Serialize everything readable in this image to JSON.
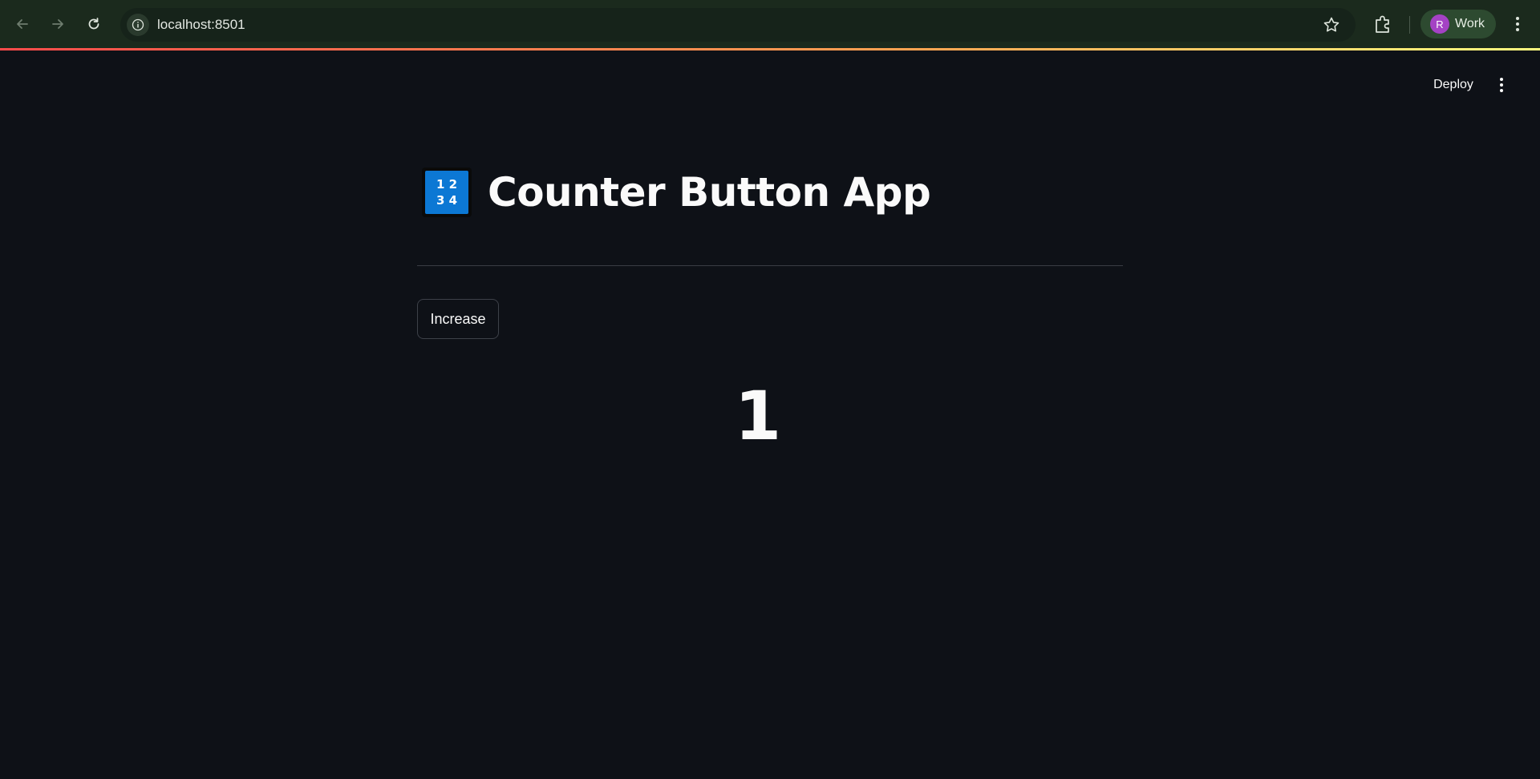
{
  "browser": {
    "url": "localhost:8501",
    "profile": {
      "initial": "R",
      "label": "Work"
    },
    "icons": [
      "back-arrow-icon",
      "forward-arrow-icon",
      "reload-icon",
      "site-info-icon",
      "star-icon",
      "extensions-icon",
      "kebab-menu-icon"
    ]
  },
  "header": {
    "deploy_label": "Deploy"
  },
  "main": {
    "title_emoji": {
      "line1": "1 2",
      "line2": "3 4"
    },
    "title": "Counter Button App",
    "button_label": "Increase",
    "counter_value": "1"
  },
  "colors": {
    "background": "#0e1117",
    "text": "#fafafa",
    "accent_gradient": [
      "#ff4b4b",
      "#ffa552",
      "#fffd80"
    ],
    "emoji_blue": "#0c78d4",
    "profile_avatar": "#a442c4"
  }
}
